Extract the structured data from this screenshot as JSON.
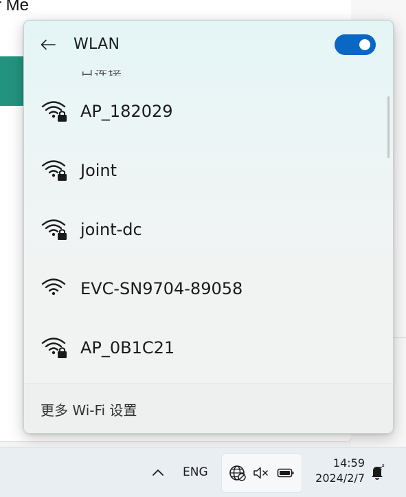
{
  "background_window": {
    "partial_text": "r Me",
    "accent_color": "#23937f"
  },
  "wlan_panel": {
    "title": "WLAN",
    "toggle_state": "on",
    "toggle_color": "#0a67c3",
    "clipped_label": "已连接",
    "networks": [
      {
        "name": "AP_182029",
        "icon": "wifi-secured-icon",
        "secured": true
      },
      {
        "name": "Joint",
        "icon": "wifi-secured-icon",
        "secured": true
      },
      {
        "name": "joint-dc",
        "icon": "wifi-secured-icon",
        "secured": true
      },
      {
        "name": "EVC-SN9704-89058",
        "icon": "wifi-icon",
        "secured": false
      },
      {
        "name": "AP_0B1C21",
        "icon": "wifi-secured-icon",
        "secured": true
      }
    ],
    "more_settings_label": "更多 Wi-Fi 设置"
  },
  "taskbar": {
    "language": "ENG",
    "time": "14:59",
    "date": "2024/2/7",
    "icons": [
      "chevron-up-icon",
      "globe-icon",
      "volume-muted-icon",
      "battery-icon",
      "notification-bell-icon"
    ]
  }
}
